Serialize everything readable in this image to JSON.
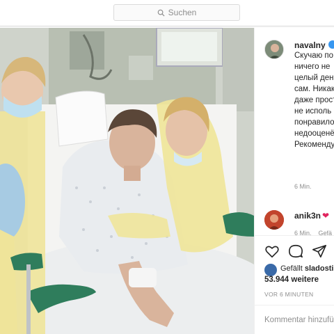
{
  "search": {
    "label": "Suchen",
    "icon": "search-icon"
  },
  "post": {
    "username": "navalny",
    "verified": true,
    "caption_lines": [
      "Скучаю по",
      "ничего не",
      "целый ден",
      "сам. Никак",
      "даже прост",
      "не исполь",
      "понравило",
      "недооценё",
      "Рекоменду"
    ],
    "time": "6 Min."
  },
  "comment": {
    "username": "anik3n",
    "meta_time": "6 Min.",
    "meta_more": "Gefä"
  },
  "likes": {
    "liked_by_prefix": "Gefällt ",
    "liked_by_user": "sladosti",
    "count": "53.944 weitere"
  },
  "posted_ago": "VOR 6 MINUTEN",
  "comment_input": {
    "placeholder": "Kommentar hinzufü"
  },
  "colors": {
    "verified": "#3897f0",
    "heart": "#e0245e",
    "muted": "#8e8e8e"
  }
}
